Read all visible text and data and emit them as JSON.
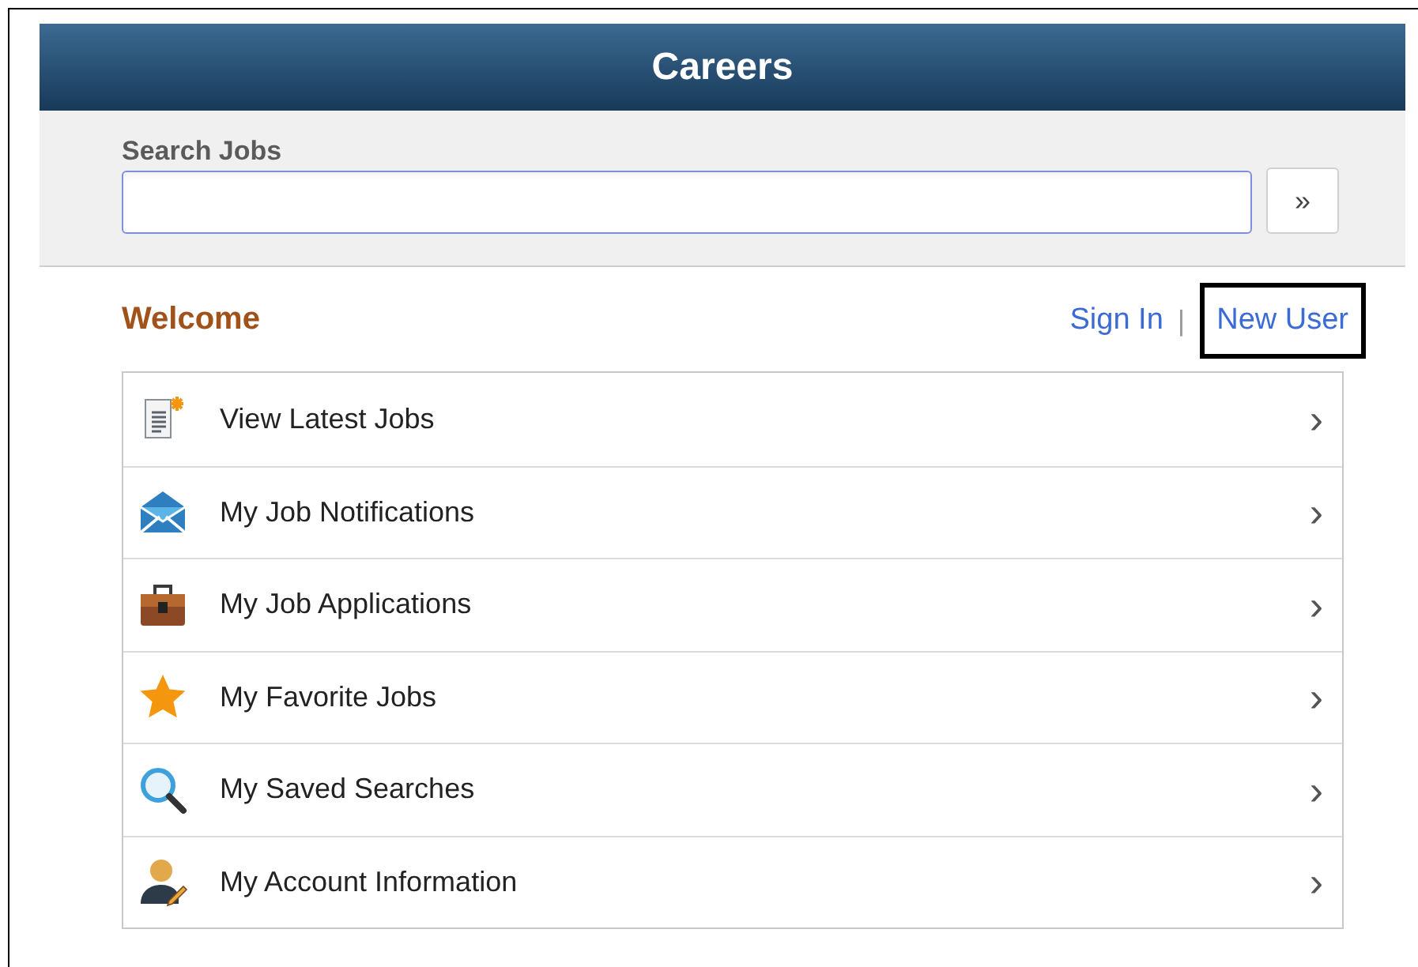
{
  "header": {
    "title": "Careers"
  },
  "search": {
    "label": "Search Jobs",
    "go_button": "»"
  },
  "welcome": {
    "title": "Welcome",
    "links": [
      {
        "label": "Sign In",
        "highlighted": false
      },
      {
        "label": "New User",
        "highlighted": true
      }
    ],
    "separator": "|"
  },
  "menu": [
    {
      "kind": "document",
      "label": "View Latest Jobs",
      "chevron": "›"
    },
    {
      "kind": "envelope",
      "label": "My Job Notifications",
      "chevron": "›"
    },
    {
      "kind": "briefcase",
      "label": "My Job Applications",
      "chevron": "›"
    },
    {
      "kind": "star",
      "label": "My Favorite Jobs",
      "chevron": "›"
    },
    {
      "kind": "magnifier",
      "label": "My Saved Searches",
      "chevron": "›"
    },
    {
      "kind": "person",
      "label": "My Account Information",
      "chevron": "›"
    }
  ]
}
